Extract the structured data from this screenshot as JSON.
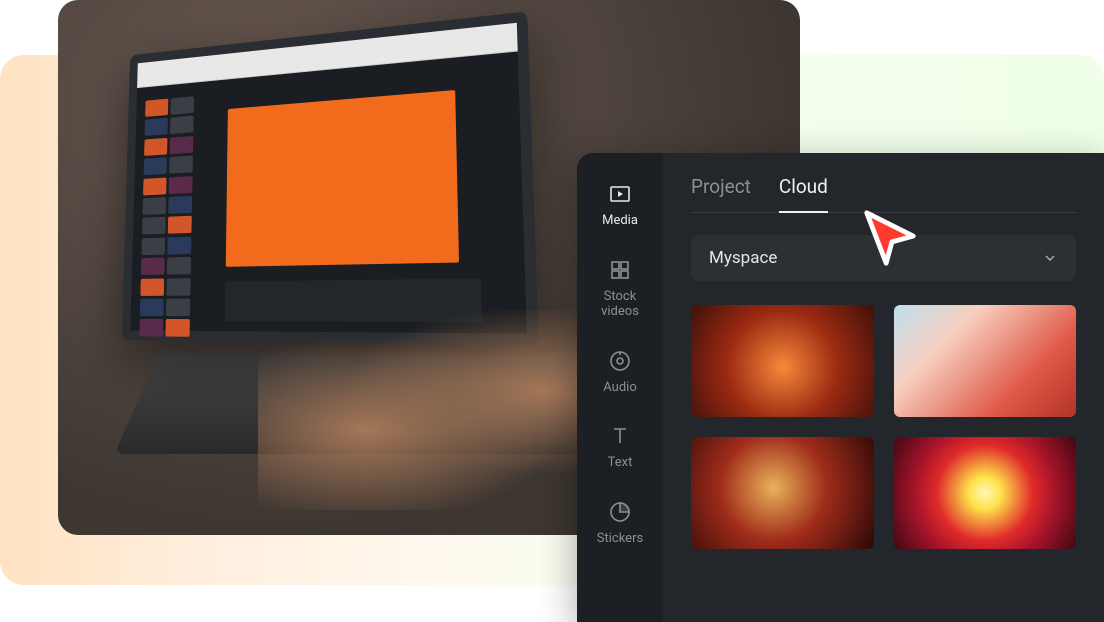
{
  "rail": {
    "items": [
      {
        "key": "media",
        "label": "Media",
        "icon": "media-icon",
        "active": true
      },
      {
        "key": "stock",
        "label": "Stock\nvideos",
        "icon": "stock-icon",
        "active": false
      },
      {
        "key": "audio",
        "label": "Audio",
        "icon": "audio-icon",
        "active": false
      },
      {
        "key": "text",
        "label": "Text",
        "icon": "text-icon",
        "active": false
      },
      {
        "key": "stickers",
        "label": "Stickers",
        "icon": "stickers-icon",
        "active": false
      }
    ]
  },
  "tabs": {
    "items": [
      {
        "key": "project",
        "label": "Project",
        "active": false
      },
      {
        "key": "cloud",
        "label": "Cloud",
        "active": true
      }
    ]
  },
  "dropdown": {
    "selected": "Myspace"
  },
  "thumbnails": [
    {
      "name": "thumb-rose"
    },
    {
      "name": "thumb-smoke"
    },
    {
      "name": "thumb-portrait"
    },
    {
      "name": "thumb-flower"
    }
  ],
  "colors": {
    "panel_bg": "#23262b",
    "rail_bg": "#1c1f23",
    "accent_cursor": "#ff3b30"
  }
}
